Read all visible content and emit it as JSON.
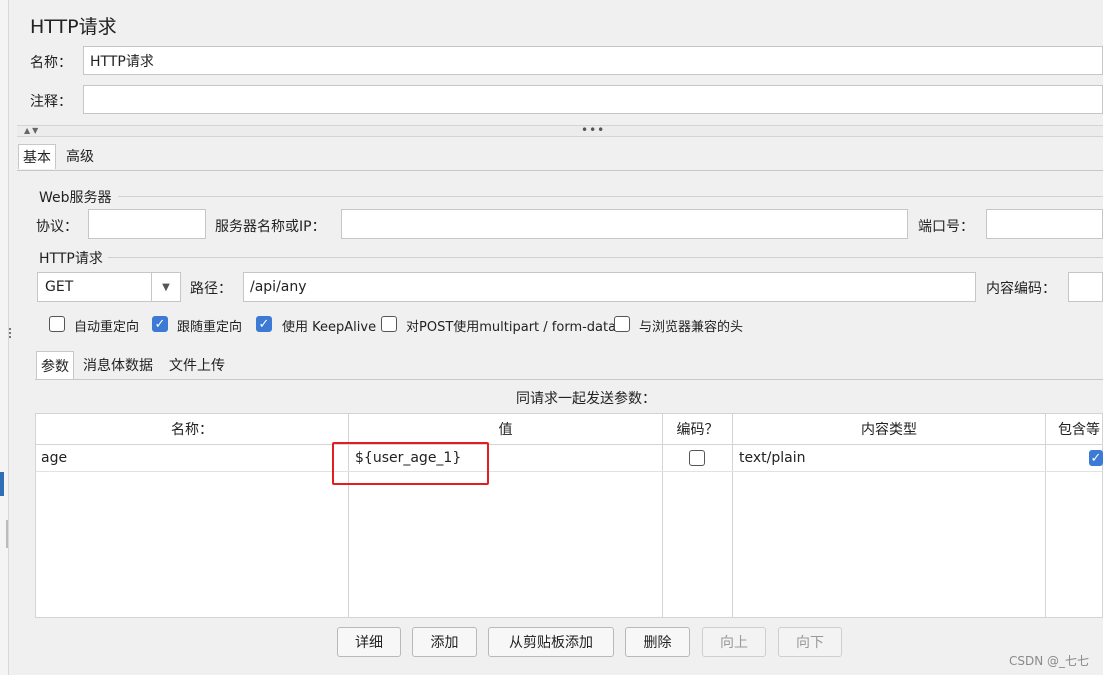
{
  "panel": {
    "title": "HTTP请求",
    "name_label": "名称：",
    "name_value": "HTTP请求",
    "comment_label": "注释：",
    "comment_value": ""
  },
  "tabs": {
    "top": [
      {
        "label": "基本",
        "active": true
      },
      {
        "label": "高级",
        "active": false
      }
    ],
    "params": [
      {
        "label": "参数",
        "active": true
      },
      {
        "label": "消息体数据",
        "active": false
      },
      {
        "label": "文件上传",
        "active": false
      }
    ]
  },
  "web_server": {
    "group_label": "Web服务器",
    "protocol_label": "协议：",
    "protocol_value": "",
    "server_label": "服务器名称或IP：",
    "server_value": "",
    "port_label": "端口号：",
    "port_value": ""
  },
  "http_request": {
    "group_label": "HTTP请求",
    "method": "GET",
    "path_label": "路径：",
    "path_value": "/api/any",
    "encoding_label": "内容编码：",
    "encoding_value": ""
  },
  "options": [
    {
      "label": "自动重定向",
      "checked": false
    },
    {
      "label": "跟随重定向",
      "checked": true
    },
    {
      "label": "使用 KeepAlive",
      "checked": true
    },
    {
      "label": "对POST使用multipart / form-data",
      "checked": false
    },
    {
      "label": "与浏览器兼容的头",
      "checked": false
    }
  ],
  "params_table": {
    "caption": "同请求一起发送参数：",
    "headers": [
      "名称：",
      "值",
      "编码？",
      "内容类型",
      "包含等"
    ],
    "rows": [
      {
        "name": "age",
        "value": "${user_age_1}",
        "encode": false,
        "content_type": "text/plain",
        "include_equals": true
      }
    ]
  },
  "buttons": [
    {
      "label": "详细",
      "enabled": true
    },
    {
      "label": "添加",
      "enabled": true
    },
    {
      "label": "从剪贴板添加",
      "enabled": true
    },
    {
      "label": "删除",
      "enabled": true
    },
    {
      "label": "向上",
      "enabled": false
    },
    {
      "label": "向下",
      "enabled": false
    }
  ],
  "watermark": "CSDN @_七七",
  "colors": {
    "accent": "#3c7ad6",
    "highlight": "#e02020"
  }
}
